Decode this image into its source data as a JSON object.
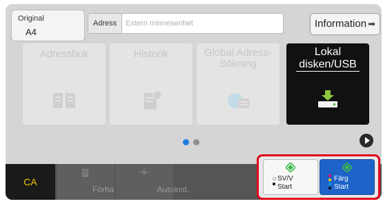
{
  "header": {
    "original_label": "Original",
    "original_value": "A4",
    "address_label": "Adress",
    "address_placeholder": "Extern minnesenhet",
    "info_label": "Information"
  },
  "tiles": [
    {
      "label": "Adressbok",
      "icon": "address-book-icon",
      "enabled": false
    },
    {
      "label": "Historik",
      "icon": "history-icon",
      "enabled": false
    },
    {
      "label": "Global Adress-Sökning",
      "icon": "global-address-search-icon",
      "enabled": false
    },
    {
      "label": "Lokal disken/USB",
      "icon": "usb-drive-icon",
      "enabled": true
    }
  ],
  "pager": {
    "pages": 2,
    "current": 1
  },
  "bottom": {
    "ca_label": "CA",
    "preview_label": "Förhandsgr.",
    "autoset_label": "Autoinst."
  },
  "start": {
    "bw_line1": "SV/V",
    "bw_line2": "Start",
    "color_line1": "Färg",
    "color_line2": "Start"
  },
  "colors": {
    "accent": "#1e63c8",
    "highlight": "#e2001a",
    "ca_text": "#f0c400",
    "start_green": "#3cb84a"
  }
}
